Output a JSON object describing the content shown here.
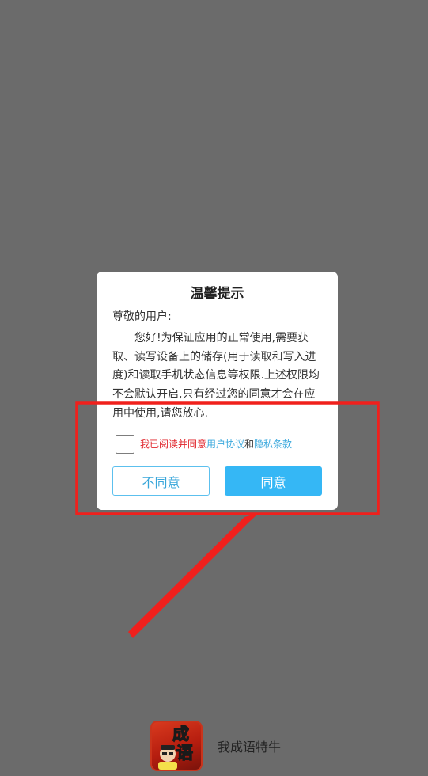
{
  "dialog": {
    "title": "温馨提示",
    "greeting": "尊敬的用户:",
    "body": "您好!为保证应用的正常使用,需要获取、读写设备上的储存(用于读取和写入进度)和读取手机状态信息等权限.上述权限均不会默认开启,只有经过您的同意才会在应用中使用,请您放心.",
    "agreement": {
      "checked": false,
      "prefix": "我已阅读并同意",
      "user_agreement_link": "用户协议",
      "conjunction": "和",
      "privacy_link": "隐私条款"
    },
    "buttons": {
      "disagree": "不同意",
      "agree": "同意"
    }
  },
  "annotation": {
    "color": "#f0201c"
  },
  "app": {
    "icon_glyphs": [
      "成",
      "语"
    ],
    "name": "我成语特牛"
  }
}
